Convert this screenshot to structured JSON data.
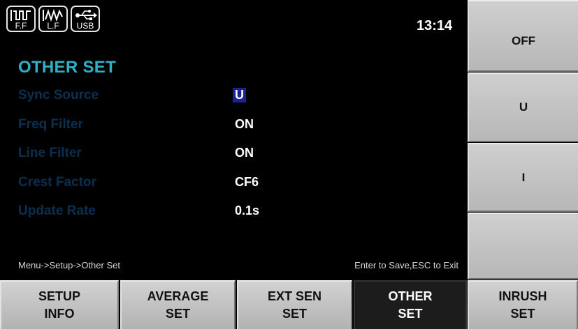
{
  "status": {
    "icons": [
      {
        "name": "freq-filter-icon",
        "label": "F.F"
      },
      {
        "name": "line-filter-icon",
        "label": "L.F"
      },
      {
        "name": "usb-icon",
        "label": "USB"
      }
    ],
    "time": "13:14"
  },
  "main": {
    "title": "OTHER SET",
    "rows": [
      {
        "label": "Sync Source",
        "value": "U"
      },
      {
        "label": "Freq Filter",
        "value": "ON"
      },
      {
        "label": "Line Filter",
        "value": "ON"
      },
      {
        "label": "Crest Factor",
        "value": "CF6"
      },
      {
        "label": "Update Rate",
        "value": "0.1s"
      }
    ],
    "path": "Menu->Setup->Other Set",
    "hint": "Enter to Save,ESC to Exit"
  },
  "softkeys": [
    "OFF",
    "U",
    "I",
    ""
  ],
  "tabs": [
    {
      "line1": "SETUP",
      "line2": "INFO"
    },
    {
      "line1": "AVERAGE",
      "line2": "SET"
    },
    {
      "line1": "EXT SEN",
      "line2": "SET"
    },
    {
      "line1": "OTHER",
      "line2": "SET"
    },
    {
      "line1": "INRUSH",
      "line2": "SET"
    }
  ],
  "colors": {
    "title": "#2fb0c5",
    "labels": "#0b2f4f",
    "selection": "#1a238f",
    "active_tab": "#1c1c1c"
  }
}
